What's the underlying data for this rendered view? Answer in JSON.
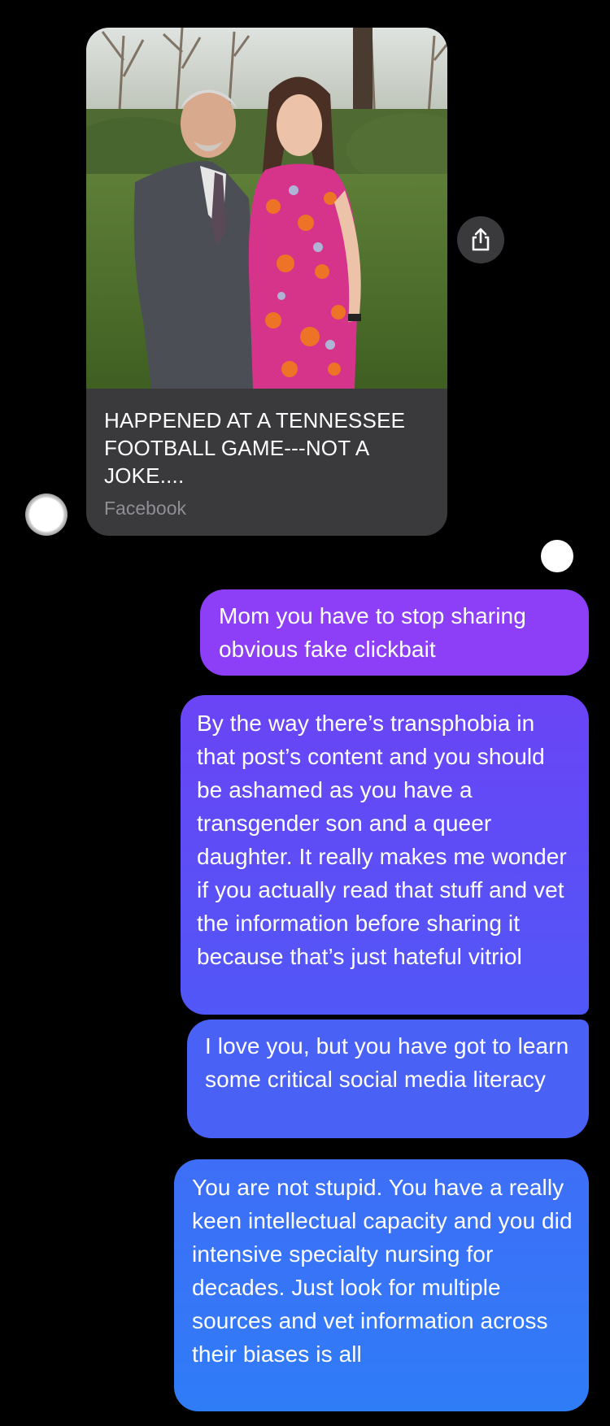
{
  "shared_link": {
    "title": "HAPPENED AT A TENNESSEE FOOTBALL GAME---NOT A JOKE....",
    "source": "Facebook",
    "share_icon": "share-icon"
  },
  "messages": [
    {
      "text": "Mom you have to stop sharing obvious fake clickbait"
    },
    {
      "text": "By the way there’s transphobia in that post’s content and you should be ashamed as you have a transgender son and a queer daughter. It really makes me wonder if you actually read that stuff and vet the information before sharing it because that’s just hateful vitriol"
    },
    {
      "text": "I love you, but you have got to learn some critical social media literacy"
    },
    {
      "text": "You are not stupid. You have a really keen intellectual capacity and you did intensive specialty nursing for decades. Just look for multiple sources and vet information across their biases is all"
    }
  ],
  "colors": {
    "background": "#000000",
    "card": "#3a3a3c",
    "bubble_purple": "#8c3ff7",
    "bubble_blue": "#2f7cf7"
  }
}
